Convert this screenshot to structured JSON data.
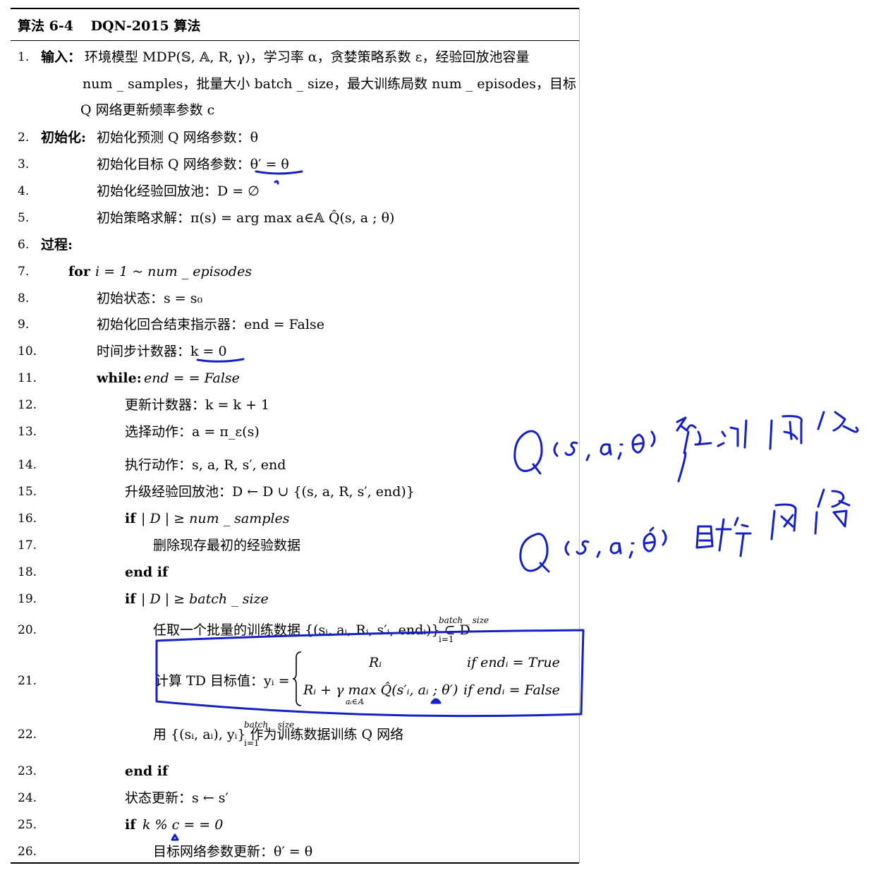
{
  "algorithm": {
    "label": "算法 6-4",
    "name": "DQN-2015 算法"
  },
  "lines": [
    {
      "n": "1.",
      "kw": "输入：",
      "text": "环境模型 MDP(𝕊, 𝔸, R, γ)，学习率 α，贪婪策略系数 ε，经验回放池容量"
    },
    {
      "n": "",
      "kw": "",
      "text": "num _ samples，批量大小 batch _ size，最大训练局数 num _ episodes，目标"
    },
    {
      "n": "",
      "kw": "",
      "text": "Q 网络更新频率参数 c"
    },
    {
      "n": "2.",
      "kw": "初始化:",
      "text": "初始化预测 Q 网络参数：θ"
    },
    {
      "n": "3.",
      "kw": "",
      "text": "初始化目标 Q 网络参数：θ′ = θ"
    },
    {
      "n": "4.",
      "kw": "",
      "text": "初始化经验回放池：D = ∅"
    },
    {
      "n": "5.",
      "kw": "",
      "text": "初始策略求解：π(s) = arg max a∈𝔸 Q̂(s, a ; θ)"
    },
    {
      "n": "6.",
      "kw": "过程:",
      "text": ""
    },
    {
      "n": "7.",
      "kw": "for",
      "text": "i = 1 ~ num _ episodes"
    },
    {
      "n": "8.",
      "kw": "",
      "text": "初始状态：s = s₀"
    },
    {
      "n": "9.",
      "kw": "",
      "text": "初始化回合结束指示器：end = False"
    },
    {
      "n": "10.",
      "kw": "",
      "text": "时间步计数器：k = 0"
    },
    {
      "n": "11.",
      "kw": "while:",
      "text": "end = = False"
    },
    {
      "n": "12.",
      "kw": "",
      "text": "更新计数器：k = k + 1"
    },
    {
      "n": "13.",
      "kw": "",
      "text": "选择动作：a = π_ε(s)"
    },
    {
      "n": "14.",
      "kw": "",
      "text": "执行动作：s, a, R, s′, end"
    },
    {
      "n": "15.",
      "kw": "",
      "text": "升级经验回放池：D ← D ∪ {(s, a, R, s′, end)}"
    },
    {
      "n": "16.",
      "kw": "if",
      "text": "| D | ≥ num _ samples"
    },
    {
      "n": "17.",
      "kw": "",
      "text": "删除现存最初的经验数据"
    },
    {
      "n": "18.",
      "kw": "end if",
      "text": ""
    },
    {
      "n": "19.",
      "kw": "if",
      "text": "| D | ≥ batch _ size"
    },
    {
      "n": "20.",
      "kw": "",
      "text": "任取一个批量的训练数据 {(sᵢ, aᵢ, Rᵢ, s′ᵢ, endᵢ)} ⊂ D"
    },
    {
      "n": "21.",
      "kw": "",
      "text": "计算 TD 目标值：yᵢ ="
    },
    {
      "n": "22.",
      "kw": "",
      "text": "用 {(sᵢ, aᵢ), yᵢ} 作为训练数据训练 Q 网络"
    },
    {
      "n": "23.",
      "kw": "end if",
      "text": ""
    },
    {
      "n": "24.",
      "kw": "",
      "text": "状态更新：s ← s′"
    },
    {
      "n": "25.",
      "kw": "if",
      "text": "k % c = = 0"
    },
    {
      "n": "26.",
      "kw": "",
      "text": "目标网络参数更新：θ′ = θ"
    }
  ],
  "line20_parts": {
    "sup": "batch _ size",
    "sub": "i=1"
  },
  "line21_cases": [
    {
      "value": "Rᵢ",
      "cond": "if  endᵢ = True"
    },
    {
      "value": "Rᵢ + γ max Q̂(s′ᵢ, aᵢ ; θ′)",
      "sub": "aᵢ∈𝔸",
      "cond": "if  endᵢ = False"
    }
  ],
  "line22_parts": {
    "sup": "batch _ size",
    "sub": "i=1"
  },
  "handwritten": {
    "note1": "Q(s,a;θ) 预测网络",
    "note2": "Q(s,a;θ′) 目标网络"
  },
  "colors": {
    "ink": "#1520c8",
    "rule": "#000000"
  }
}
